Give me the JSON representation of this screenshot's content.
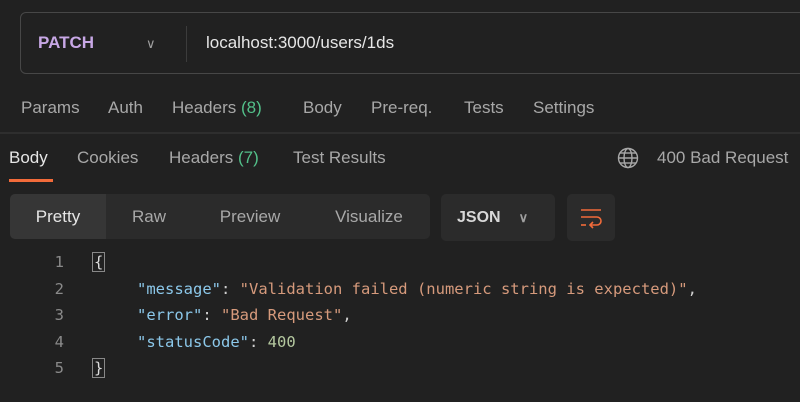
{
  "request": {
    "method": "PATCH",
    "url": "localhost:3000/users/1ds",
    "tabs": [
      {
        "label": "Params"
      },
      {
        "label": "Auth"
      },
      {
        "label": "Headers",
        "count": "(8)"
      },
      {
        "label": "Body"
      },
      {
        "label": "Pre-req."
      },
      {
        "label": "Tests"
      },
      {
        "label": "Settings"
      }
    ]
  },
  "response": {
    "tabs": [
      {
        "label": "Body"
      },
      {
        "label": "Cookies"
      },
      {
        "label": "Headers",
        "count": "(7)"
      },
      {
        "label": "Test Results"
      }
    ],
    "status": "400 Bad Request",
    "views": [
      "Pretty",
      "Raw",
      "Preview",
      "Visualize"
    ],
    "format": "JSON",
    "lines": [
      "1",
      "2",
      "3",
      "4",
      "5"
    ],
    "body": {
      "open": "{",
      "close": "}",
      "k1": "\"message\"",
      "v1": "\"Validation failed (numeric string is expected)\"",
      "k2": "\"error\"",
      "v2": "\"Bad Request\"",
      "k3": "\"statusCode\"",
      "v3": "400",
      "colon": ": ",
      "comma": ","
    }
  },
  "colors": {
    "accent": "#f26b3a",
    "success": "#53c08a",
    "method": "#c8a8e6"
  }
}
